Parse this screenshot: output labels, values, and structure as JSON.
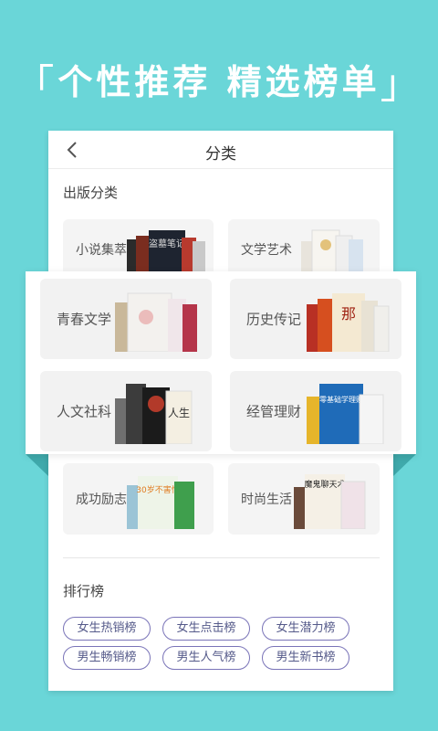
{
  "headline": {
    "open_bracket": "「",
    "text": "个性推荐 精选榜单",
    "close_bracket": "」"
  },
  "nav": {
    "back_icon": "chevron-left-icon",
    "title": "分类"
  },
  "publish": {
    "title": "出版分类",
    "categories": [
      {
        "label": "小说集萃"
      },
      {
        "label": "文学艺术"
      },
      {
        "label": "青春文学"
      },
      {
        "label": "历史传记"
      },
      {
        "label": "人文社科"
      },
      {
        "label": "经管理财"
      },
      {
        "label": "成功励志"
      },
      {
        "label": "时尚生活"
      }
    ],
    "book_covers": {
      "novel": "盗墓笔记",
      "econ": "零基础学理财",
      "success": "30岁不害怕",
      "fashion": "魔鬼聊天术"
    }
  },
  "ranking": {
    "title": "排行榜",
    "chips": [
      {
        "label": "女生热销榜"
      },
      {
        "label": "女生点击榜"
      },
      {
        "label": "女生潜力榜"
      },
      {
        "label": "男生畅销榜"
      },
      {
        "label": "男生人气榜"
      },
      {
        "label": "男生新书榜"
      }
    ]
  }
}
